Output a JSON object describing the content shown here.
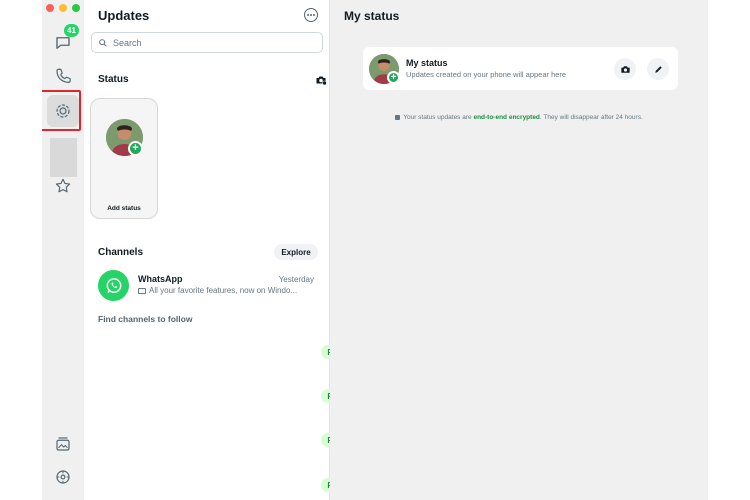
{
  "colors": {
    "accent": "#25d366",
    "follow_bg": "#d9fdd3",
    "follow_text": "#1d8b42",
    "highlight": "#e3262d"
  },
  "rail": {
    "chats_badge": "41",
    "icons": [
      "chat-icon",
      "phone-icon",
      "status-icon",
      "star-icon",
      "media-icon",
      "settings-icon"
    ]
  },
  "list": {
    "title": "Updates",
    "search_placeholder": "Search",
    "status": {
      "section_title": "Status",
      "add_status_label": "Add status"
    },
    "channels": {
      "section_title": "Channels",
      "explore_label": "Explore",
      "items": [
        {
          "name": "WhatsApp",
          "time": "Yesterday",
          "message": "All your favorite features, now on Windo..."
        }
      ],
      "find_title": "Find channels to follow",
      "follow_label": "Follow"
    }
  },
  "main": {
    "title": "My status",
    "card": {
      "name": "My status",
      "subtitle": "Updates created on your phone will appear here"
    },
    "encryption": {
      "prefix": "Your status updates are ",
      "link": "end-to-end encrypted",
      "suffix": ". They will disappear after 24 hours."
    }
  }
}
